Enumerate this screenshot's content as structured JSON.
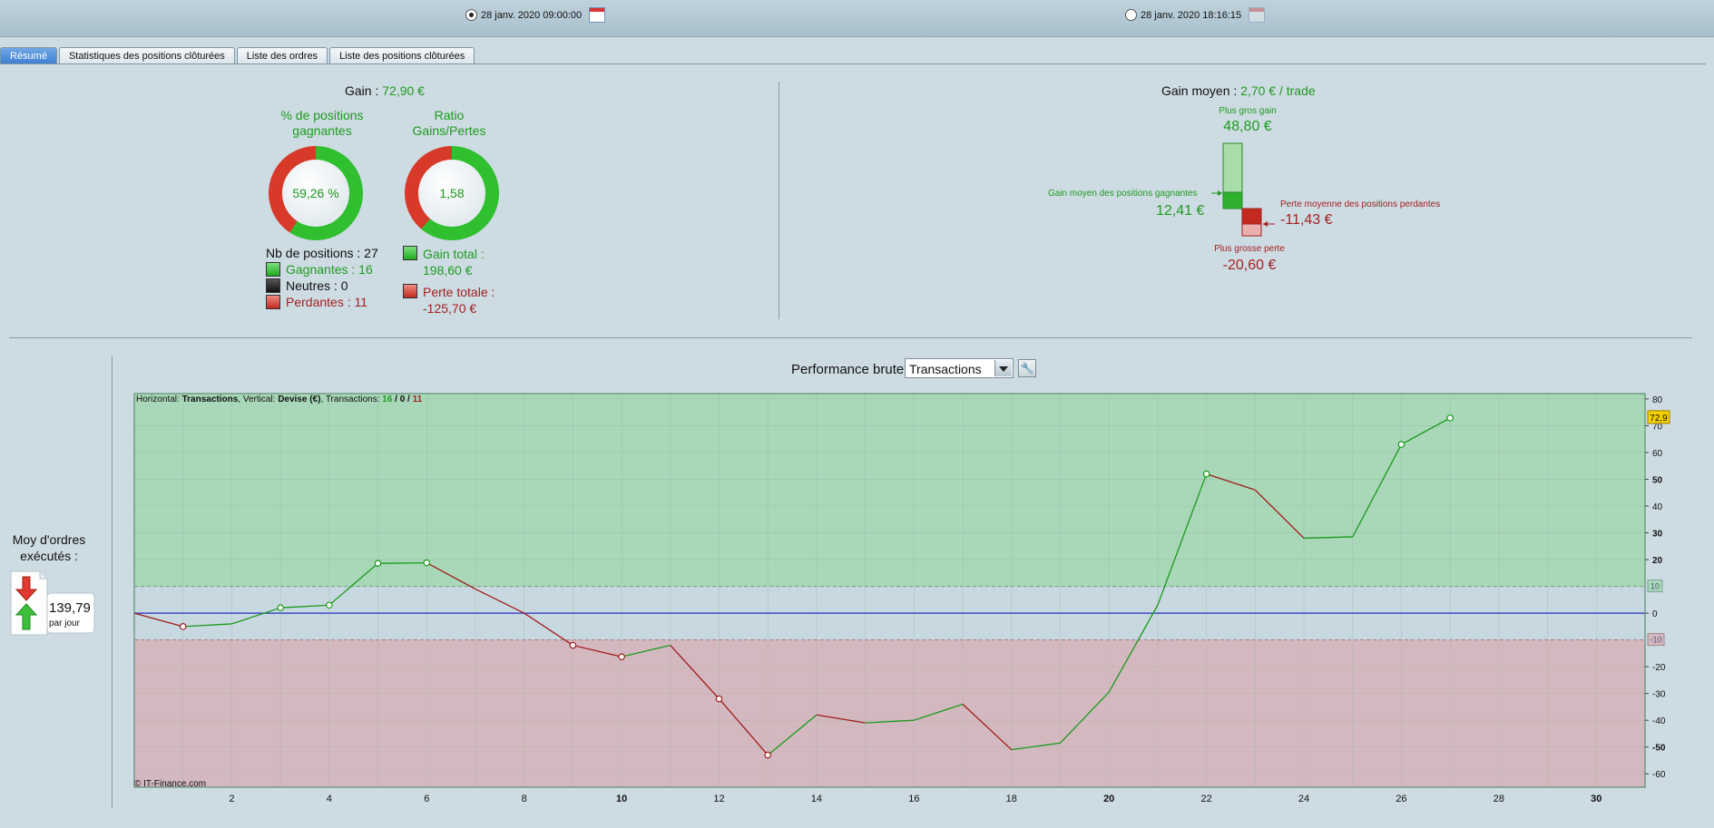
{
  "dates": {
    "from": "28 janv. 2020 09:00:00",
    "to": "28 janv. 2020 18:16:15"
  },
  "tabs": [
    "Résumé",
    "Statistiques des positions clôturées",
    "Liste des ordres",
    "Liste des positions clôturées"
  ],
  "summary": {
    "gain_label": "Gain : ",
    "gain_value": "72,90 €",
    "pct_title_1": "% de positions",
    "pct_title_2": "gagnantes",
    "pct_value": "59,26 %",
    "pct_fraction": 0.5926,
    "ratio_title_1": "Ratio",
    "ratio_title_2": "Gains/Pertes",
    "ratio_value": "1,58",
    "ratio_fraction": 0.6124,
    "nb_positions": "Nb de positions : 27",
    "winners": "Gagnantes : 16",
    "neutral": "Neutres : 0",
    "losers": "Perdantes : 11",
    "gain_total_label": "Gain total :",
    "gain_total_value": "198,60 €",
    "loss_total_label": "Perte totale :",
    "loss_total_value": "-125,70 €"
  },
  "average": {
    "label": "Gain moyen : ",
    "value": "2,70 € / trade",
    "biggest_gain_label": "Plus gros gain",
    "biggest_gain_value": "48,80 €",
    "avg_win_label": "Gain moyen des positions gagnantes",
    "avg_win_value": "12,41 €",
    "avg_loss_label": "Perte moyenne des positions perdantes",
    "avg_loss_value": "-11,43 €",
    "biggest_loss_label": "Plus grosse perte",
    "biggest_loss_value": "-20,60 €"
  },
  "orders": {
    "label_1": "Moy d'ordres",
    "label_2": "exécutés :",
    "value": "139,79",
    "unit": "par jour"
  },
  "perf": {
    "label": "Performance brute",
    "select_value": "Transactions",
    "info_prefix": "Horizontal: ",
    "info_h": "Transactions",
    "info_mid": ", Vertical: ",
    "info_v": "Devise (€)",
    "info_mid2": ", Transactions: ",
    "info_win": "16",
    "info_sep1": " / ",
    "info_neutral": "0",
    "info_sep2": " / ",
    "info_loss": "11",
    "copyright": "© IT-Finance.com",
    "last_value_tag": "72,9",
    "threshold_up_tag": "10",
    "threshold_down_tag": "-10"
  },
  "chart_data": {
    "type": "line",
    "x": [
      0,
      1,
      2,
      3,
      4,
      5,
      6,
      7,
      8,
      9,
      10,
      11,
      12,
      13,
      14,
      15,
      16,
      17,
      18,
      19,
      20,
      21,
      22,
      23,
      24,
      25,
      26,
      27
    ],
    "y": [
      0,
      -5,
      -4,
      2,
      3,
      18.6,
      18.8,
      9,
      0,
      -12,
      -16.3,
      -12,
      -32,
      -53,
      -38,
      -41,
      -40,
      -34,
      -51,
      -48.5,
      -29.5,
      3,
      52,
      46,
      28,
      28.5,
      63,
      72.9
    ],
    "trade_result": [
      "",
      "loss",
      "win",
      "win",
      "win",
      "win",
      "win",
      "loss",
      "loss",
      "loss",
      "loss",
      "win",
      "loss",
      "loss",
      "win",
      "loss",
      "win",
      "win",
      "loss",
      "win",
      "win",
      "win",
      "win",
      "loss",
      "loss",
      "win",
      "win",
      "win"
    ],
    "xlim": [
      0,
      31
    ],
    "ylim": [
      -65,
      82
    ],
    "xticks": [
      2,
      4,
      6,
      8,
      10,
      12,
      14,
      16,
      18,
      20,
      22,
      24,
      26,
      28,
      30
    ],
    "yticks": [
      80,
      70,
      60,
      50,
      40,
      30,
      20,
      0,
      -20,
      -30,
      -40,
      -50,
      -60
    ],
    "bold_ticks": [
      10,
      20,
      30,
      50,
      -50
    ],
    "upper_threshold": 10,
    "lower_threshold": -10,
    "colors": {
      "win": "#1a9a1a",
      "loss": "#a01c1c",
      "zero": "#2030c0",
      "upper_zone": "#a8d8b8",
      "lower_zone": "#d4b8c0",
      "mid_zone": "#c8d8e0"
    }
  }
}
